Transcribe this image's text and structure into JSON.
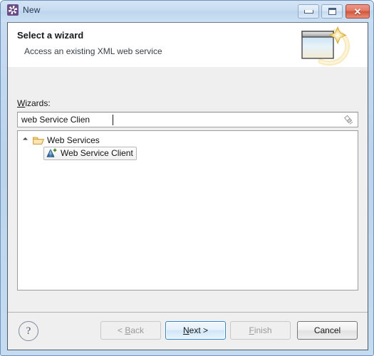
{
  "window": {
    "title": "New",
    "app_icon": "gear-icon",
    "controls": {
      "minimize": "minimize-icon",
      "maximize": "maximize-icon",
      "close_glyph": "✕"
    }
  },
  "header": {
    "title": "Select a wizard",
    "subtitle": "Access an existing XML web service",
    "banner_icon": "wizard-window-sparkle-icon"
  },
  "content": {
    "wizards_label_mnemonic": "W",
    "wizards_label_rest": "izards:",
    "filter": {
      "value": "web Service Clien",
      "placeholder": "type filter text",
      "clear_icon": "clear-eraser-icon"
    },
    "tree": [
      {
        "label": "Web Services",
        "icon": "open-folder-icon",
        "expanded": true,
        "selected": false
      },
      {
        "label": "Web Service Client",
        "icon": "web-service-client-icon",
        "expanded": false,
        "selected": true
      }
    ]
  },
  "buttons": {
    "help": "?",
    "back": {
      "label_pre": "< ",
      "mnemonic": "B",
      "label_post": "ack",
      "enabled": false
    },
    "next": {
      "label_pre": "",
      "mnemonic": "N",
      "label_post": "ext >",
      "enabled": true,
      "default": true
    },
    "finish": {
      "label_pre": "",
      "mnemonic": "F",
      "label_post": "inish",
      "enabled": false
    },
    "cancel": {
      "label_pre": "",
      "mnemonic": "",
      "label_post": "Cancel",
      "enabled": true
    }
  },
  "colors": {
    "frame": "#bcd4ec",
    "dialog_bg": "#efefef",
    "header_bg": "#ffffff",
    "close_button": "#d0553c",
    "default_button_border": "#2f87c9",
    "folder": "#f0c060"
  }
}
